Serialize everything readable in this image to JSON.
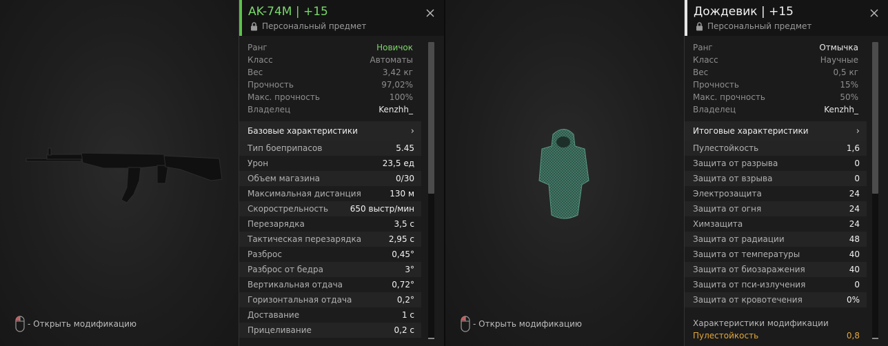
{
  "left": {
    "title": "AK-74M | +15",
    "personal": "Персональный предмет",
    "hint": "- Открыть модификацию",
    "info": [
      {
        "label": "Ранг",
        "value": "Новичок"
      },
      {
        "label": "Класс",
        "value": "Автоматы"
      },
      {
        "label": "Вес",
        "value": "3,42 кг"
      },
      {
        "label": "Прочность",
        "value": "97,02%"
      },
      {
        "label": "Макс. прочность",
        "value": "100%"
      },
      {
        "label": "Владелец",
        "value": "Kenzhh_"
      }
    ],
    "section": "Базовые характеристики",
    "stats": [
      {
        "label": "Тип боеприпасов",
        "value": "5.45"
      },
      {
        "label": "Урон",
        "value": "23,5 ед"
      },
      {
        "label": "Объем магазина",
        "value": "0/30"
      },
      {
        "label": "Максимальная дистанция",
        "value": "130 м"
      },
      {
        "label": "Скорострельность",
        "value": "650 выстр/мин"
      },
      {
        "label": "Перезарядка",
        "value": "3,5 с"
      },
      {
        "label": "Тактическая перезарядка",
        "value": "2,95 с"
      },
      {
        "label": "Разброс",
        "value": "0,45°"
      },
      {
        "label": "Разброс от бедра",
        "value": "3°"
      },
      {
        "label": "Вертикальная отдача",
        "value": "0,72°"
      },
      {
        "label": "Горизонтальная отдача",
        "value": "0,2°"
      },
      {
        "label": "Доставание",
        "value": "1 с"
      },
      {
        "label": "Прицеливание",
        "value": "0,2 с"
      }
    ]
  },
  "right": {
    "title": "Дождевик | +15",
    "personal": "Персональный предмет",
    "hint": "- Открыть модификацию",
    "info": [
      {
        "label": "Ранг",
        "value": "Отмычка"
      },
      {
        "label": "Класс",
        "value": "Научные"
      },
      {
        "label": "Вес",
        "value": "0,5 кг"
      },
      {
        "label": "Прочность",
        "value": "15%"
      },
      {
        "label": "Макс. прочность",
        "value": "50%"
      },
      {
        "label": "Владелец",
        "value": "Kenzhh_"
      }
    ],
    "section": "Итоговые характеристики",
    "stats": [
      {
        "label": "Пулестойкость",
        "value": "1,6"
      },
      {
        "label": "Защита от разрыва",
        "value": "0"
      },
      {
        "label": "Защита от взрыва",
        "value": "0"
      },
      {
        "label": "Электрозащита",
        "value": "24"
      },
      {
        "label": "Защита от огня",
        "value": "24"
      },
      {
        "label": "Химзащита",
        "value": "24"
      },
      {
        "label": "Защита от радиации",
        "value": "48"
      },
      {
        "label": "Защита от температуры",
        "value": "40"
      },
      {
        "label": "Защита от биозаражения",
        "value": "40"
      },
      {
        "label": "Защита от пси-излучения",
        "value": "0"
      },
      {
        "label": "Защита от кровотечения",
        "value": "0%"
      }
    ],
    "mod_title": "Характеристики модификации",
    "mod_stat": {
      "label": "Пулестойкость",
      "value": "0,8"
    }
  },
  "colors": {
    "rank_green": "#7ed66b",
    "title_green": "#78d86a",
    "mod_orange": "#e3a73a",
    "accent_green": "#5cc24b"
  },
  "icons": {
    "close": "close-icon",
    "lock": "lock-icon",
    "mouse": "mouse-icon",
    "chevron": "chevron-right-icon"
  }
}
